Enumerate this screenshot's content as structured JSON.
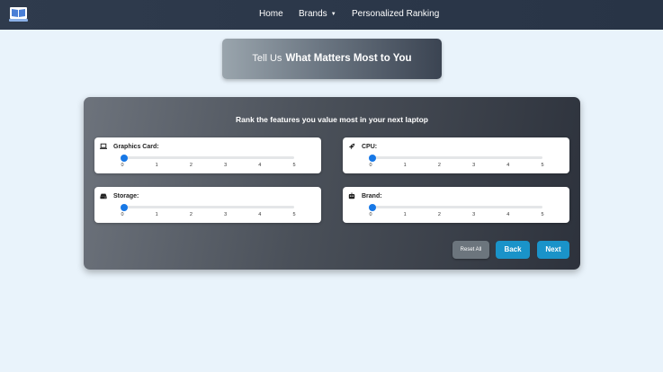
{
  "navbar": {
    "logo_icon": "laptop-book-icon",
    "links": {
      "home": "Home",
      "brands": "Brands",
      "ranking": "Personalized Ranking"
    }
  },
  "hero": {
    "lead": "Tell Us",
    "strong": "What Matters Most to You"
  },
  "panel": {
    "title": "Rank the features you value most in your next laptop",
    "tick_labels": [
      "0",
      "1",
      "2",
      "3",
      "4",
      "5"
    ],
    "features": [
      {
        "label": "Graphics Card:",
        "icon": "laptop-icon",
        "value": 0,
        "min": 0,
        "max": 5
      },
      {
        "label": "CPU:",
        "icon": "rocket-icon",
        "value": 0,
        "min": 0,
        "max": 5
      },
      {
        "label": "Storage:",
        "icon": "hard-drive-icon",
        "value": 0,
        "min": 0,
        "max": 5
      },
      {
        "label": "Brand:",
        "icon": "robot-icon",
        "value": 0,
        "min": 0,
        "max": 5
      }
    ],
    "buttons": {
      "reset": "Reset All",
      "back": "Back",
      "next": "Next"
    }
  },
  "colors": {
    "accent": "#1a93c9",
    "slider_thumb": "#1778e6",
    "navbar": "#2f3b4d",
    "page_background": "#e9f3fb"
  }
}
